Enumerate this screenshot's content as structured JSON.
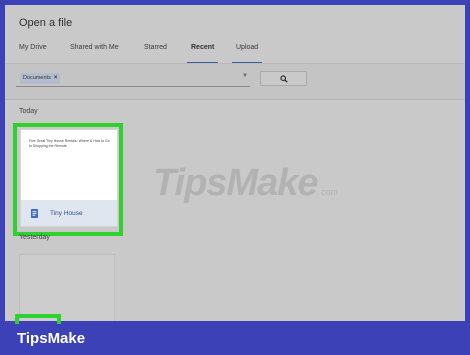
{
  "dialog": {
    "title": "Open a file"
  },
  "tabs": [
    {
      "label": "My Drive",
      "active": false
    },
    {
      "label": "Shared with Me",
      "active": false
    },
    {
      "label": "Starred",
      "active": false
    },
    {
      "label": "Recent",
      "active": true
    },
    {
      "label": "Upload",
      "active": false
    }
  ],
  "search": {
    "chip_label": "Documents",
    "chip_remove": "×",
    "dropdown_icon": "caret-down-icon",
    "button_icon": "search-icon"
  },
  "sections": {
    "today": "Today",
    "yesterday": "Yesterday"
  },
  "files": [
    {
      "name": "Tiny House",
      "preview_text": "Five Great Tiny House Rentals: Where & How to Go to Shopping the Remote",
      "icon": "docs-icon",
      "highlighted": true
    }
  ],
  "watermark": {
    "text": "TipsMake",
    "suffix": ".com"
  },
  "brand": "TipsMake",
  "colors": {
    "highlight": "#2fd12f",
    "brand_bar": "#3c41b8",
    "dialog_bg": "#c9c9c9",
    "tab_underline": "#3a5aa6"
  }
}
